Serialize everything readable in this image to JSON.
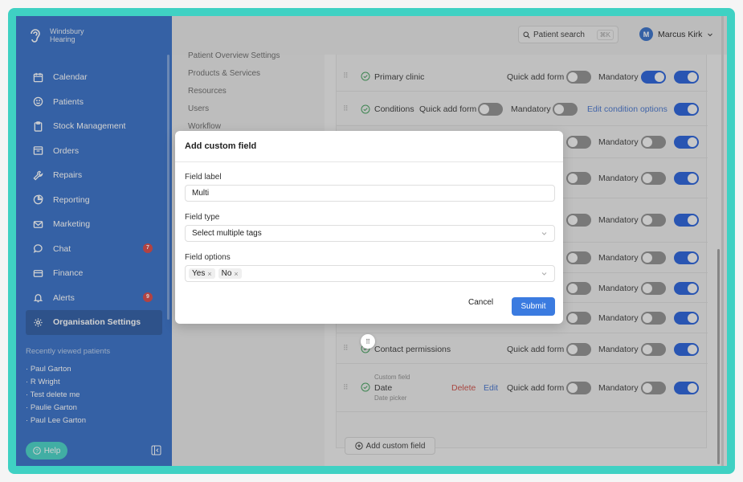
{
  "brand": {
    "name_line1": "Windsbury",
    "name_line2": "Hearing"
  },
  "sidebar": {
    "items": [
      {
        "label": "Calendar",
        "icon": "calendar-icon"
      },
      {
        "label": "Patients",
        "icon": "smiley-icon"
      },
      {
        "label": "Stock Management",
        "icon": "clipboard-icon"
      },
      {
        "label": "Orders",
        "icon": "box-icon"
      },
      {
        "label": "Repairs",
        "icon": "wrench-icon"
      },
      {
        "label": "Reporting",
        "icon": "pie-chart-icon"
      },
      {
        "label": "Marketing",
        "icon": "mail-icon"
      },
      {
        "label": "Chat",
        "icon": "chat-icon",
        "badge": "7"
      },
      {
        "label": "Finance",
        "icon": "card-icon"
      },
      {
        "label": "Alerts",
        "icon": "bell-icon",
        "badge": "9"
      },
      {
        "label": "Organisation Settings",
        "icon": "gear-icon"
      }
    ],
    "recent_title": "Recently viewed patients",
    "recent": [
      "Paul Garton",
      "R Wright",
      "Test delete me",
      "Paulie Garton",
      "Paul Lee Garton"
    ],
    "help_label": "Help"
  },
  "topbar": {
    "search_label": "Patient search",
    "shortcut": "⌘K",
    "user_initial": "M",
    "user_name": "Marcus Kirk"
  },
  "settings_menu": {
    "items": [
      "Patient Overview Settings",
      "Products & Services",
      "Resources",
      "Users",
      "Workflow"
    ]
  },
  "fields": {
    "primary_clinic": "Primary clinic",
    "conditions": "Conditions",
    "edit_condition_options": "Edit condition options",
    "contact_permissions": "Contact permissions",
    "custom_field": "Custom field",
    "date": "Date",
    "date_picker": "Date picker",
    "delete": "Delete",
    "edit": "Edit",
    "quick_add_form": "Quick add form",
    "mandatory": "Mandatory",
    "add_custom_field": "Add custom field"
  },
  "modal": {
    "title": "Add custom field",
    "label_label": "Field label",
    "label_value": "Multi",
    "type_label": "Field type",
    "type_value": "Select multiple tags",
    "options_label": "Field options",
    "options": [
      "Yes",
      "No"
    ],
    "cancel": "Cancel",
    "submit": "Submit"
  },
  "colors": {
    "sidebar": "#2f6ac4",
    "accent": "#3b7be0",
    "frame": "#3fd1c3",
    "badge": "#d64141"
  }
}
